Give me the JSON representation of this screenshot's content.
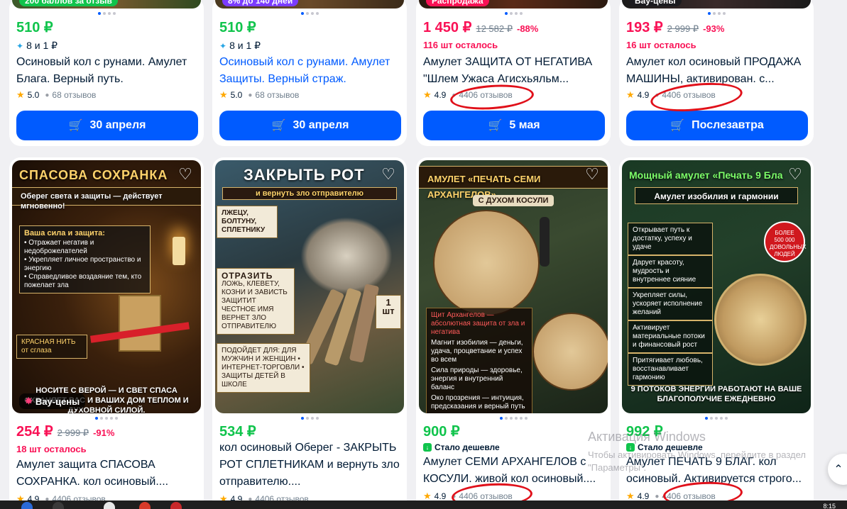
{
  "top_cards": [
    {
      "badge": "200 баллов за отзыв",
      "badge_color": "#10c44c",
      "price": "510 ₽",
      "price_color": "green",
      "bonus": "8 и 1 ₽",
      "title": "Осиновый кол с рунами. Амулет Блага. Верный путь.",
      "title_link": false,
      "rating": "5.0",
      "reviews": "68 отзывов",
      "button": "30 апреля"
    },
    {
      "badge": "8% до 140 дней",
      "badge_color": "#7b3cff",
      "price": "510 ₽",
      "price_color": "green",
      "bonus": "8 и 1 ₽",
      "title": "Осиновый кол с рунами. Амулет Защиты. Верный страж.",
      "title_link": true,
      "rating": "5.0",
      "reviews": "68 отзывов",
      "button": "30 апреля"
    },
    {
      "badge": "Распродажа",
      "badge_color": "#f91155",
      "price": "1 450 ₽",
      "price_color": "pink",
      "old_price": "12 582 ₽",
      "discount": "-88%",
      "stock": "116 шт осталось",
      "title": "Амулет ЗАЩИТА ОТ НЕГАТИВА \"Шлем Ужаса Агисхьяльм...",
      "title_link": false,
      "rating": "4.9",
      "reviews": "4406 отзывов",
      "button": "5 мая"
    },
    {
      "badge": "Вау-цены",
      "badge_color": "#1b1b1f",
      "price": "193 ₽",
      "price_color": "pink",
      "old_price": "2 999 ₽",
      "discount": "-93%",
      "stock": "16 шт осталось",
      "title": "Амулет кол осиновый ПРОДАЖА МАШИНЫ, активирован. с...",
      "title_link": false,
      "rating": "4.9",
      "reviews": "4406 отзывов",
      "button": "Послезавтра"
    }
  ],
  "bottom_cards": [
    {
      "photo_title": "СПАСОВА СОХРАНКА",
      "photo_subtitle": "Оберег света и защиты — действует мгновенно!",
      "photo_box_title": "Ваша сила и защита:",
      "photo_box_lines": [
        "• Отражает негатив и недоброжелателей",
        "• Укрепляет личное пространство и энергию",
        "• Справедливое воздаяние тем, кто пожелает зла"
      ],
      "photo_label": "КРАСНАЯ НИТЬ от сглаза",
      "photo_footer": "НОСИТЕ С ВЕРОЙ — И СВЕТ СПАСА ОХРАНЯЕТ ВАС И ВАШИХ ДОМ ТЕПЛОМ И ДУХОВНОЙ СИЛОЙ.",
      "photo_badge": "Вау-цены",
      "price": "254 ₽",
      "price_color": "pink",
      "old_price": "2 999 ₽",
      "discount": "-91%",
      "stock": "18 шт осталось",
      "title": "Амулет защита СПАСОВА СОХРАНКА. кол осиновый....",
      "rating": "4.9",
      "reviews": "4406 отзывов"
    },
    {
      "photo_title": "ЗАКРЫТЬ РОТ",
      "photo_subtitle": "и вернуть зло отправителю",
      "photo_box_title": "ЛЖЕЦУ, БОЛТУНУ, СПЛЕТНИКУ",
      "photo_box_lines": [
        "ОТРАЗИТЬ",
        "ЛОЖЬ, КЛЕВЕТУ, КОЗНИ И ЗАВИСТЬ",
        "ЗАЩИТИТ ЧЕСТНОЕ ИМЯ",
        "ВЕРНЕТ ЗЛО ОТПРАВИТЕЛЮ"
      ],
      "photo_label": "1 шт",
      "photo_footer": "ПОДОЙДЕТ ДЛЯ: ДЛЯ МУЖЧИН И ЖЕНЩИН • ИНТЕРНЕТ-ТОРГОВЛИ • ЗАЩИТЫ ДЕТЕЙ В ШКОЛЕ",
      "price": "534 ₽",
      "price_color": "green",
      "title": "кол осиновый Оберег - ЗАКРЫТЬ РОТ СПЛЕТНИКАМ и вернуть зло отправителю....",
      "rating": "4.9",
      "reviews": "4406 отзывов"
    },
    {
      "photo_title": "АМУЛЕТ «ПЕЧАТЬ СЕМИ АРХАНГЕЛОВ»",
      "photo_subtitle": "С ДУХОМ КОСУЛИ",
      "photo_box_title": "Щит Архангелов — абсолютная защита от зла и негатива",
      "photo_box_lines": [
        "Магнит изобилия — деньги, удача, процветание и успех во всем",
        "Сила природы — здоровье, энергия и внутренний баланс",
        "Око прозрения — интуиция, предсказания и верный путь"
      ],
      "price": "900 ₽",
      "price_color": "green",
      "cheaper": "Стало дешевле",
      "title": "Амулет СЕМИ АРХАНГЕЛОВ с КОСУЛИ. живой кол осиновый....",
      "rating": "4.9",
      "reviews": "4406 отзывов"
    },
    {
      "photo_title": "Мощный амулет «Печать 9 Бла",
      "photo_subtitle": "Амулет изобилия и гармонии",
      "photo_box_lines": [
        "Открывает путь к достатку, успеху и удаче",
        "Дарует красоту, мудрость и внутреннее сияние",
        "Укрепляет силы, ускоряет исполнение желаний",
        "Активирует материальные потоки и финансовый рост",
        "Притягивает любовь, восстанавливает гармонию"
      ],
      "photo_label": "БОЛЕЕ 500 000 ДОВОЛЬНЫХ ЛЮДЕЙ",
      "photo_footer": "9 ПОТОКОВ ЭНЕРГИИ РАБОТАЮТ НА ВАШЕ БЛАГОПОЛУЧИЕ ЕЖЕДНЕВНО",
      "price": "992 ₽",
      "price_color": "green",
      "cheaper": "Стало дешевле",
      "title": "Амулет ПЕЧАТЬ 9 БЛАГ. кол осиновый. Активируется строго...",
      "rating": "4.9",
      "reviews": "4406 отзывов"
    }
  ],
  "watermark": {
    "title": "Активация Windows",
    "text": "Чтобы активировать Windows, перейдите в раздел \"Параметры\"."
  },
  "taskbar_time": "8:15",
  "colors": {
    "accent": "#005bff",
    "price_green": "#10c44c",
    "price_pink": "#f91155",
    "annotation_red": "#e0101a"
  }
}
